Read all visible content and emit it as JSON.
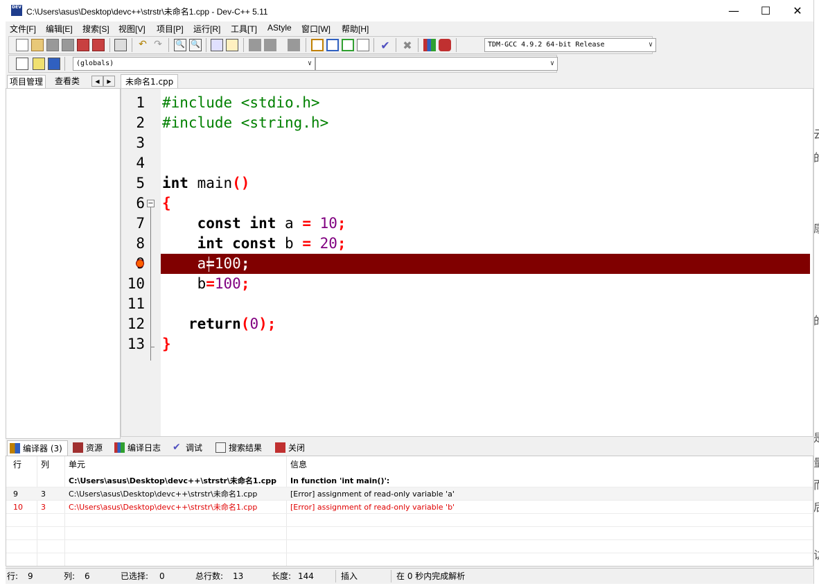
{
  "window": {
    "title": "C:\\Users\\asus\\Desktop\\devc++\\strstr\\未命名1.cpp - Dev-C++ 5.11",
    "app_icon_text": "DEV"
  },
  "menu": [
    "文件[F]",
    "编辑[E]",
    "搜索[S]",
    "视图[V]",
    "项目[P]",
    "运行[R]",
    "工具[T]",
    "AStyle",
    "窗口[W]",
    "帮助[H]"
  ],
  "compiler_select": "TDM-GCC 4.9.2 64-bit Release",
  "scope_select": "(globals)",
  "symbol_select": "",
  "left_panel": {
    "tabs": [
      "项目管理",
      "查看类"
    ]
  },
  "editor": {
    "tab_label": "未命名1.cpp",
    "lines": [
      {
        "n": "1",
        "tokens": [
          {
            "t": "pp",
            "v": "#include <stdio.h>"
          }
        ]
      },
      {
        "n": "2",
        "tokens": [
          {
            "t": "pp",
            "v": "#include <string.h>"
          }
        ]
      },
      {
        "n": "3",
        "tokens": []
      },
      {
        "n": "4",
        "tokens": []
      },
      {
        "n": "5",
        "tokens": [
          {
            "t": "kw",
            "v": "int"
          },
          {
            "t": "id",
            "v": " main"
          },
          {
            "t": "sym",
            "v": "()"
          }
        ]
      },
      {
        "n": "6",
        "tokens": [
          {
            "t": "sym",
            "v": "{"
          }
        ]
      },
      {
        "n": "7",
        "tokens": [
          {
            "t": "id",
            "v": "    "
          },
          {
            "t": "kw",
            "v": "const int"
          },
          {
            "t": "id",
            "v": " a "
          },
          {
            "t": "sym",
            "v": "="
          },
          {
            "t": "id",
            "v": " "
          },
          {
            "t": "num",
            "v": "10"
          },
          {
            "t": "sym",
            "v": ";"
          }
        ]
      },
      {
        "n": "8",
        "tokens": [
          {
            "t": "id",
            "v": "    "
          },
          {
            "t": "kw",
            "v": "int const"
          },
          {
            "t": "id",
            "v": " b "
          },
          {
            "t": "sym",
            "v": "="
          },
          {
            "t": "id",
            "v": " "
          },
          {
            "t": "num",
            "v": "20"
          },
          {
            "t": "sym",
            "v": ";"
          }
        ]
      },
      {
        "n": "9",
        "tokens": [
          {
            "t": "id",
            "v": "    a"
          },
          {
            "t": "sym",
            "v": "="
          },
          {
            "t": "num",
            "v": "100"
          },
          {
            "t": "sym",
            "v": ";"
          }
        ]
      },
      {
        "n": "10",
        "tokens": [
          {
            "t": "id",
            "v": "    b"
          },
          {
            "t": "sym",
            "v": "="
          },
          {
            "t": "num",
            "v": "100"
          },
          {
            "t": "sym",
            "v": ";"
          }
        ]
      },
      {
        "n": "11",
        "tokens": []
      },
      {
        "n": "12",
        "tokens": [
          {
            "t": "id",
            "v": "   "
          },
          {
            "t": "kw",
            "v": "return"
          },
          {
            "t": "sym",
            "v": "("
          },
          {
            "t": "num",
            "v": "0"
          },
          {
            "t": "sym",
            "v": ");"
          }
        ]
      },
      {
        "n": "13",
        "tokens": [
          {
            "t": "sym",
            "v": "}"
          }
        ]
      }
    ],
    "error_line": "9"
  },
  "bottom_tabs": [
    "编译器 (3)",
    "资源",
    "编译日志",
    "调试",
    "搜索结果",
    "关闭"
  ],
  "messages": {
    "columns": [
      "行",
      "列",
      "单元",
      "信息"
    ],
    "rows": [
      {
        "line": "",
        "col": "",
        "unit": "C:\\Users\\asus\\Desktop\\devc++\\strstr\\未命名1.cpp",
        "msg": "In function 'int main()':",
        "style": "bold"
      },
      {
        "line": "9",
        "col": "3",
        "unit": "C:\\Users\\asus\\Desktop\\devc++\\strstr\\未命名1.cpp",
        "msg": "[Error] assignment of read-only variable 'a'",
        "style": "sel"
      },
      {
        "line": "10",
        "col": "3",
        "unit": "C:\\Users\\asus\\Desktop\\devc++\\strstr\\未命名1.cpp",
        "msg": "[Error] assignment of read-only variable 'b'",
        "style": "red"
      }
    ]
  },
  "status": {
    "row_label": "行:",
    "row": "9",
    "col_label": "列:",
    "col": "6",
    "sel_label": "已选择:",
    "sel": "0",
    "total_label": "总行数:",
    "total": "13",
    "len_label": "长度:",
    "len": "144",
    "mode": "插入",
    "parse": "在 0 秒内完成解析"
  },
  "background_page_chars": [
    "云",
    "的",
    "康",
    "的",
    "是",
    "量",
    "而",
    "后",
    "访"
  ],
  "colors": {
    "error_line_bg": "#800000",
    "preprocessor": "#008000",
    "symbol": "#ff0000",
    "number": "#800080"
  }
}
